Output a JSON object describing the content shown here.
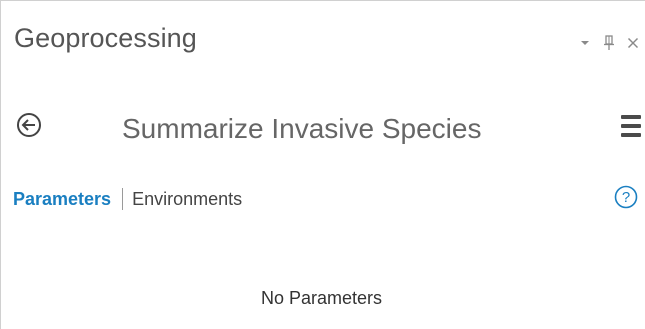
{
  "window": {
    "title": "Geoprocessing",
    "controls": {
      "dropdown_icon": "chevron-down-icon",
      "pin_icon": "pin-icon",
      "close_icon": "close-icon",
      "close_label": "×"
    }
  },
  "tool": {
    "back_icon": "back-arrow-icon",
    "name": "Summarize Invasive Species",
    "menu_icon": "hamburger-menu-icon"
  },
  "tabs": {
    "parameters": "Parameters",
    "environments": "Environments",
    "help_icon": "help-icon",
    "help_label": "?"
  },
  "body": {
    "message": "No Parameters"
  },
  "colors": {
    "accent": "#1a7fc1",
    "text": "#333333",
    "muted": "#8a8a8a"
  }
}
